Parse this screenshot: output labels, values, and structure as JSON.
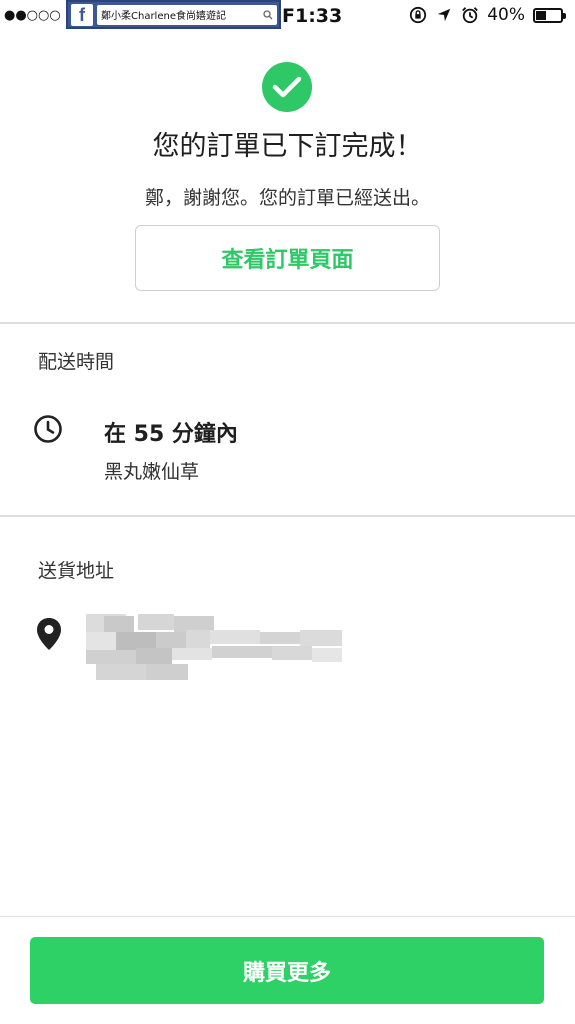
{
  "status_bar": {
    "signal": "●●○○○",
    "time": "F1:33",
    "battery": "40%",
    "battery_level": 0.4
  },
  "fb_badge": {
    "logo": "f",
    "search_text": "鄭小柔Charlene食尚嬉遊記"
  },
  "success": {
    "title": "您的訂單已下訂完成！",
    "subtitle": "鄭，謝謝您。您的訂單已經送出。",
    "view_order_label": "查看訂單頁面"
  },
  "delivery": {
    "section_label": "配送時間",
    "time": "在 55 分鐘內",
    "store": "黑丸嫩仙草"
  },
  "address": {
    "section_label": "送貨地址"
  },
  "footer": {
    "buy_more_label": "購買更多"
  },
  "colors": {
    "accent": "#2ec866",
    "button": "#2ed165"
  },
  "icons": [
    "check-icon",
    "clock-icon",
    "location-pin-icon",
    "search-icon",
    "rotation-lock-icon",
    "location-arrow-icon",
    "alarm-icon",
    "battery-icon"
  ]
}
